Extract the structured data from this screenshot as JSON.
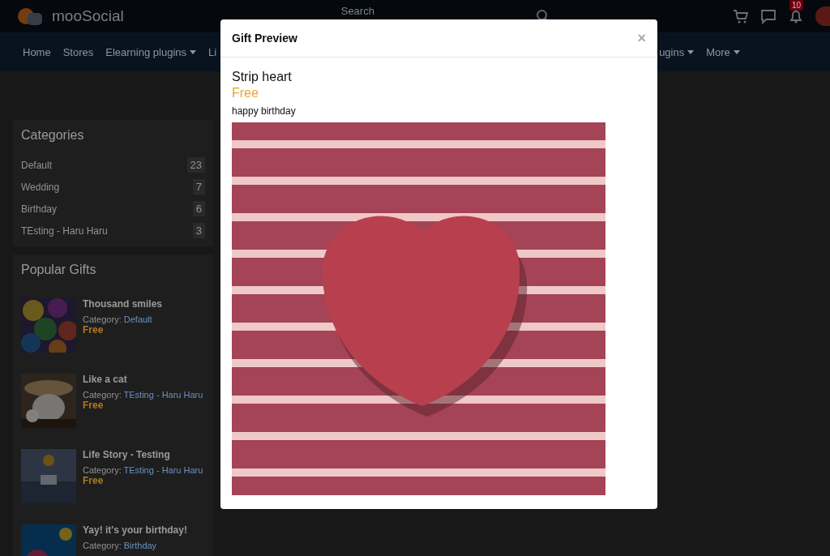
{
  "header": {
    "logo": "mooSocial",
    "search": {
      "placeholder": "Search"
    },
    "notification_count": "10"
  },
  "nav": [
    {
      "label": "Home",
      "dropdown": false
    },
    {
      "label": "Stores",
      "dropdown": false
    },
    {
      "label": "Elearning plugins",
      "dropdown": true
    },
    {
      "label": "Li",
      "dropdown": false
    },
    {
      "label": "ugins",
      "dropdown": true
    },
    {
      "label": "More",
      "dropdown": true
    }
  ],
  "categories": {
    "title": "Categories",
    "items": [
      {
        "name": "Default",
        "count": "23"
      },
      {
        "name": "Wedding",
        "count": "7"
      },
      {
        "name": "Birthday",
        "count": "6"
      },
      {
        "name": "TEsting - Haru Haru",
        "count": "3"
      }
    ]
  },
  "popular_gifts": {
    "title": "Popular Gifts",
    "items": [
      {
        "title": "Thousand smiles",
        "category_label": "Category:",
        "category": "Default",
        "price": "Free",
        "kind": "smiles"
      },
      {
        "title": "Like a cat",
        "category_label": "Category:",
        "category": "TEsting - Haru Haru",
        "price": "Free",
        "kind": "cat"
      },
      {
        "title": "Life Story - Testing",
        "category_label": "Category:",
        "category": "TEsting - Haru Haru",
        "price": "Free",
        "kind": "balloon"
      },
      {
        "title": "Yay! it's your birthday!",
        "category_label": "Category:",
        "category": "Birthday",
        "kind": "birthday"
      }
    ]
  },
  "modal": {
    "title": "Gift Preview",
    "close": "×",
    "gift_name": "Strip heart",
    "price": "Free",
    "message": "happy birthday"
  }
}
